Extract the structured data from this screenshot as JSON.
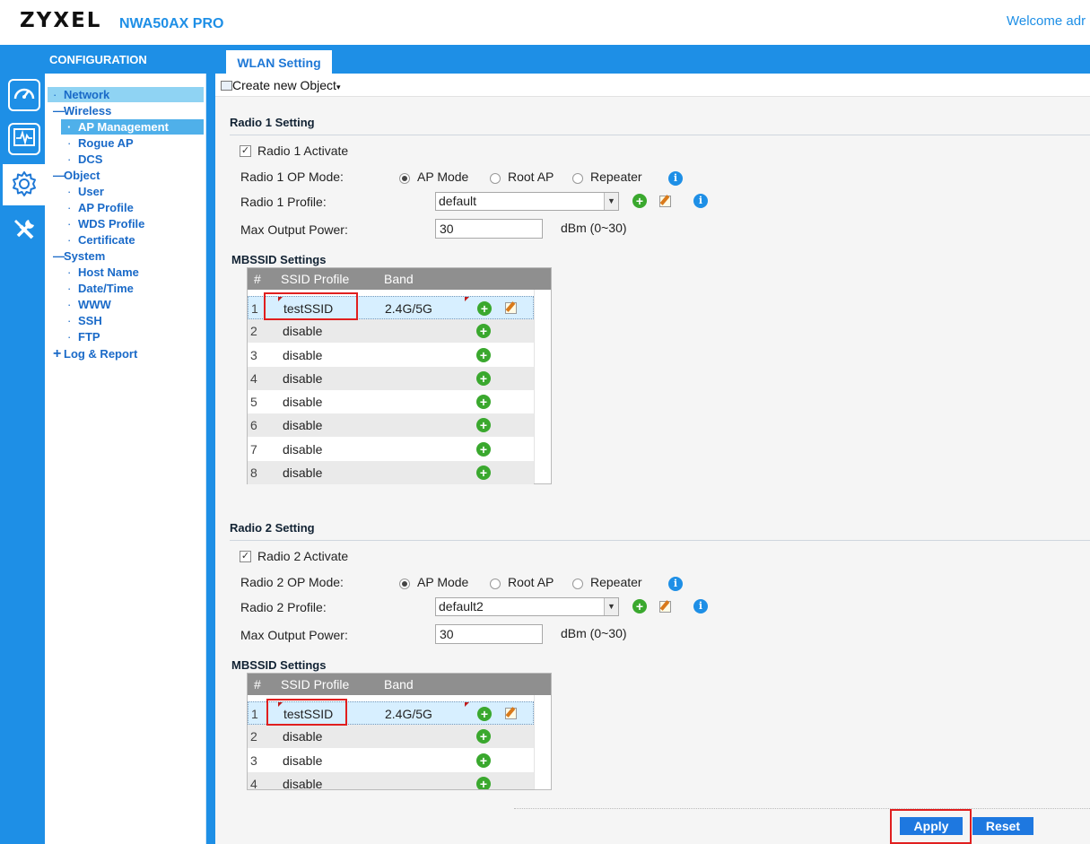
{
  "header": {
    "logo": "ZYXEL",
    "model": "NWA50AX PRO",
    "welcome": "Welcome adr"
  },
  "topbar": {
    "config_title": "CONFIGURATION",
    "tab": "WLAN Setting"
  },
  "sidebar_icons": [
    "dashboard-icon",
    "monitor-icon",
    "gear-icon",
    "maintenance-icon"
  ],
  "nav": {
    "network": "Network",
    "wireless": "Wireless",
    "ap_management": "AP Management",
    "rogue_ap": "Rogue AP",
    "dcs": "DCS",
    "object": "Object",
    "user": "User",
    "ap_profile": "AP Profile",
    "wds_profile": "WDS Profile",
    "certificate": "Certificate",
    "system": "System",
    "host_name": "Host Name",
    "date_time": "Date/Time",
    "www": "WWW",
    "ssh": "SSH",
    "ftp": "FTP",
    "log_report": "Log & Report"
  },
  "toolbar": {
    "create_object": "Create new Object"
  },
  "radio1": {
    "title": "Radio 1 Setting",
    "activate_label": "Radio 1 Activate",
    "activated": true,
    "op_mode_label": "Radio 1 OP Mode:",
    "op_modes": [
      "AP Mode",
      "Root AP",
      "Repeater"
    ],
    "op_mode_selected": "AP Mode",
    "profile_label": "Radio 1 Profile:",
    "profile_value": "default",
    "power_label": "Max Output Power:",
    "power_value": "30",
    "power_unit": "dBm (0~30)"
  },
  "radio2": {
    "title": "Radio 2 Setting",
    "activate_label": "Radio 2 Activate",
    "activated": true,
    "op_mode_label": "Radio 2 OP Mode:",
    "op_modes": [
      "AP Mode",
      "Root AP",
      "Repeater"
    ],
    "op_mode_selected": "AP Mode",
    "profile_label": "Radio 2 Profile:",
    "profile_value": "default2",
    "power_label": "Max Output Power:",
    "power_value": "30",
    "power_unit": "dBm (0~30)"
  },
  "mbssid1": {
    "title": "MBSSID Settings",
    "headers": [
      "#",
      "SSID Profile",
      "Band"
    ],
    "rows": [
      {
        "n": "1",
        "profile": "testSSID",
        "band": "2.4G/5G"
      },
      {
        "n": "2",
        "profile": "disable",
        "band": ""
      },
      {
        "n": "3",
        "profile": "disable",
        "band": ""
      },
      {
        "n": "4",
        "profile": "disable",
        "band": ""
      },
      {
        "n": "5",
        "profile": "disable",
        "band": ""
      },
      {
        "n": "6",
        "profile": "disable",
        "band": ""
      },
      {
        "n": "7",
        "profile": "disable",
        "band": ""
      },
      {
        "n": "8",
        "profile": "disable",
        "band": ""
      }
    ]
  },
  "mbssid2": {
    "title": "MBSSID Settings",
    "headers": [
      "#",
      "SSID Profile",
      "Band"
    ],
    "rows": [
      {
        "n": "1",
        "profile": "testSSID",
        "band": "2.4G/5G"
      },
      {
        "n": "2",
        "profile": "disable",
        "band": ""
      },
      {
        "n": "3",
        "profile": "disable",
        "band": ""
      },
      {
        "n": "4",
        "profile": "disable",
        "band": ""
      }
    ]
  },
  "buttons": {
    "apply": "Apply",
    "reset": "Reset"
  },
  "colors": {
    "accent": "#1e8fe6",
    "highlight": "#e01f1f",
    "add": "#3aa82e"
  }
}
